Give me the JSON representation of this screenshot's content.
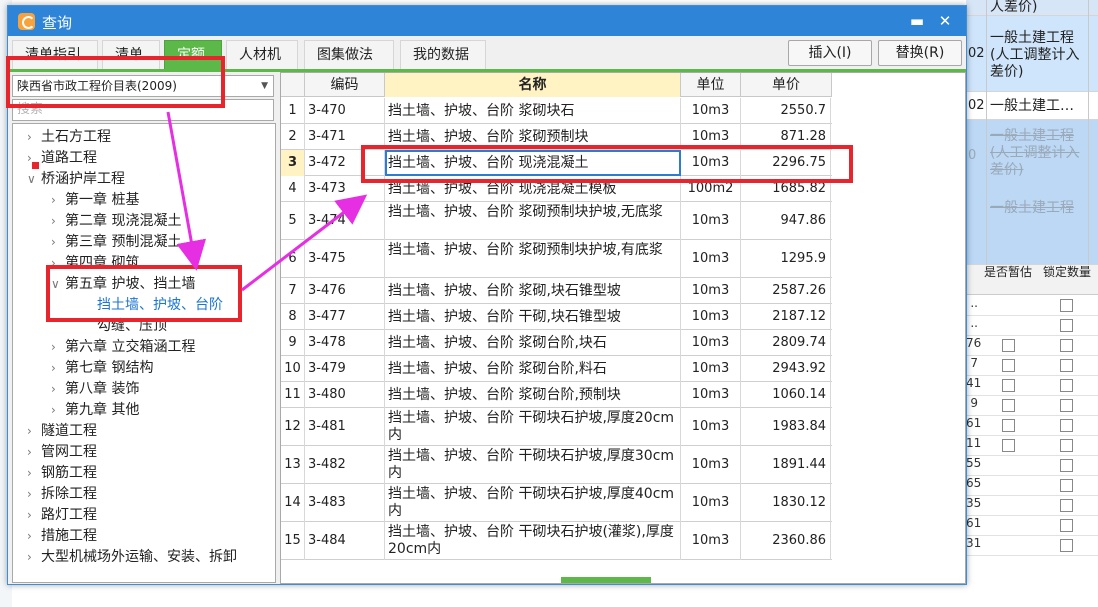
{
  "window": {
    "title": "查询"
  },
  "tabs": [
    {
      "label": "清单指引"
    },
    {
      "label": "清单"
    },
    {
      "label": "定额",
      "active": true
    },
    {
      "label": "人材机"
    },
    {
      "label": "图集做法"
    },
    {
      "label": "我的数据"
    }
  ],
  "buttons": {
    "insert": "插入(I)",
    "replace": "替换(R)"
  },
  "left": {
    "selector_value": "陕西省市政工程价目表(2009)",
    "search_placeholder": "搜索",
    "tree": [
      {
        "label": "土石方工程",
        "level": 0,
        "icon": "chevron-right"
      },
      {
        "label": "道路工程",
        "level": 0,
        "icon": "chevron-right"
      },
      {
        "label": "桥涵护岸工程",
        "level": 0,
        "icon": "chevron-down"
      },
      {
        "label": "第一章 桩基",
        "level": 1,
        "icon": "chevron-right"
      },
      {
        "label": "第二章 现浇混凝土",
        "level": 1,
        "icon": "chevron-right"
      },
      {
        "label": "第三章 预制混凝土",
        "level": 1,
        "icon": "chevron-right"
      },
      {
        "label": "第四章 砌筑",
        "level": 1,
        "icon": "chevron-right"
      },
      {
        "label": "第五章 护坡、挡土墙",
        "level": 1,
        "icon": "chevron-down"
      },
      {
        "label": "挡土墙、护坡、台阶",
        "level": 2,
        "selected": true
      },
      {
        "label": "勾缝、压顶",
        "level": 2
      },
      {
        "label": "第六章 立交箱涵工程",
        "level": 1,
        "icon": "chevron-right"
      },
      {
        "label": "第七章 钢结构",
        "level": 1,
        "icon": "chevron-right"
      },
      {
        "label": "第八章 装饰",
        "level": 1,
        "icon": "chevron-right"
      },
      {
        "label": "第九章 其他",
        "level": 1,
        "icon": "chevron-right"
      },
      {
        "label": "隧道工程",
        "level": 0,
        "icon": "chevron-right"
      },
      {
        "label": "管网工程",
        "level": 0,
        "icon": "chevron-right"
      },
      {
        "label": "钢筋工程",
        "level": 0,
        "icon": "chevron-right"
      },
      {
        "label": "拆除工程",
        "level": 0,
        "icon": "chevron-right"
      },
      {
        "label": "路灯工程",
        "level": 0,
        "icon": "chevron-right"
      },
      {
        "label": "措施工程",
        "level": 0,
        "icon": "chevron-right"
      },
      {
        "label": "大型机械场外运输、安装、拆卸",
        "level": 0,
        "icon": "chevron-right"
      }
    ]
  },
  "grid": {
    "columns": [
      "编码",
      "名称",
      "单位",
      "单价"
    ],
    "rows": [
      {
        "idx": "1",
        "code": "3-470",
        "name": "挡土墙、护坡、台阶 浆砌块石",
        "unit": "10m3",
        "price": "2550.7"
      },
      {
        "idx": "2",
        "code": "3-471",
        "name": "挡土墙、护坡、台阶 浆砌预制块",
        "unit": "10m3",
        "price": "871.28"
      },
      {
        "idx": "3",
        "code": "3-472",
        "name": "挡土墙、护坡、台阶 现浇混凝土",
        "unit": "10m3",
        "price": "2296.75",
        "active": true
      },
      {
        "idx": "4",
        "code": "3-473",
        "name": "挡土墙、护坡、台阶 现浇混凝土模板",
        "unit": "100m2",
        "price": "1685.82"
      },
      {
        "idx": "5",
        "code": "3-474",
        "name": "挡土墙、护坡、台阶 浆砌预制块护坡,无底浆",
        "unit": "10m3",
        "price": "947.86"
      },
      {
        "idx": "6",
        "code": "3-475",
        "name": "挡土墙、护坡、台阶 浆砌预制块护坡,有底浆",
        "unit": "10m3",
        "price": "1295.9"
      },
      {
        "idx": "7",
        "code": "3-476",
        "name": "挡土墙、护坡、台阶 浆砌,块石锥型坡",
        "unit": "10m3",
        "price": "2587.26"
      },
      {
        "idx": "8",
        "code": "3-477",
        "name": "挡土墙、护坡、台阶 干砌,块石锥型坡",
        "unit": "10m3",
        "price": "2187.12"
      },
      {
        "idx": "9",
        "code": "3-478",
        "name": "挡土墙、护坡、台阶 浆砌台阶,块石",
        "unit": "10m3",
        "price": "2809.74"
      },
      {
        "idx": "10",
        "code": "3-479",
        "name": "挡土墙、护坡、台阶 浆砌台阶,料石",
        "unit": "10m3",
        "price": "2943.92"
      },
      {
        "idx": "11",
        "code": "3-480",
        "name": "挡土墙、护坡、台阶 浆砌台阶,预制块",
        "unit": "10m3",
        "price": "1060.14"
      },
      {
        "idx": "12",
        "code": "3-481",
        "name": "挡土墙、护坡、台阶 干砌块石护坡,厚度20cm内",
        "unit": "10m3",
        "price": "1983.84"
      },
      {
        "idx": "13",
        "code": "3-482",
        "name": "挡土墙、护坡、台阶 干砌块石护坡,厚度30cm内",
        "unit": "10m3",
        "price": "1891.44"
      },
      {
        "idx": "14",
        "code": "3-483",
        "name": "挡土墙、护坡、台阶 干砌块石护坡,厚度40cm内",
        "unit": "10m3",
        "price": "1830.12"
      },
      {
        "idx": "15",
        "code": "3-484",
        "name": "挡土墙、护坡、台阶 干砌块石护坡(灌浆),厚度20cm内",
        "unit": "10m3",
        "price": "2360.86"
      }
    ]
  },
  "background": {
    "right_top": [
      {
        "code": "",
        "text": "人差价)"
      },
      {
        "code": "02",
        "text": "一般土建工程(人工调整计入差价)"
      },
      {
        "code": "02",
        "text": "一般土建工…"
      },
      {
        "code": "0",
        "text": "一般土建工程(人工调整计入差价)",
        "struck": true
      }
    ],
    "right_top_extra": "一般土建工程",
    "right_lower_headers": [
      "是否暂估",
      "锁定数量"
    ],
    "right_lower_nums": [
      "..",
      "..",
      "76",
      "7",
      "41",
      "9",
      "61",
      "11",
      "55",
      "65",
      "35",
      "61",
      "31"
    ]
  },
  "colors": {
    "accent": "#2e84d6",
    "tab_active": "#5bb849",
    "annotation": "#e8242d",
    "arrow": "#e62ee3"
  }
}
